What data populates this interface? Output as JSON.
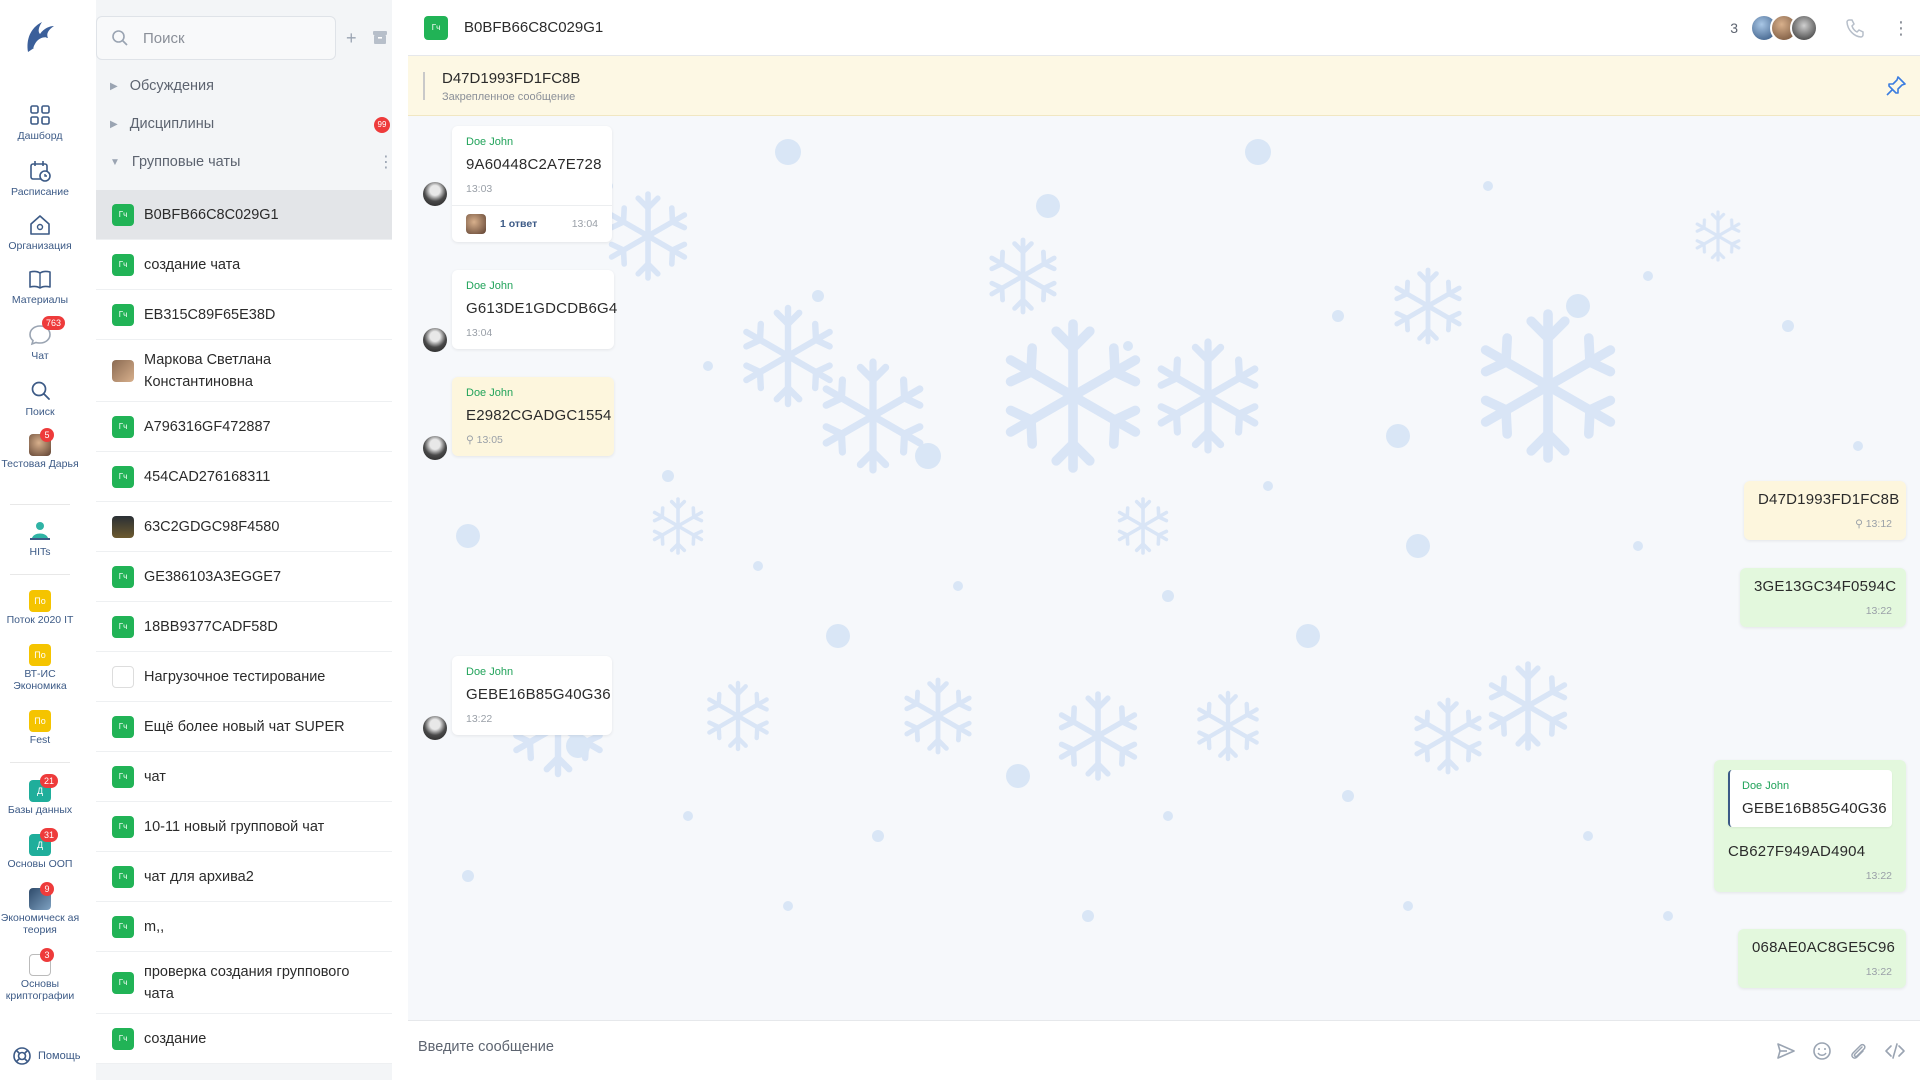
{
  "rail": {
    "items": [
      {
        "label": "Дашборд",
        "icon": "dashboard-icon"
      },
      {
        "label": "Расписание",
        "icon": "calendar-icon"
      },
      {
        "label": "Организация",
        "icon": "home-icon"
      },
      {
        "label": "Материалы",
        "icon": "book-icon"
      },
      {
        "label": "Чат",
        "icon": "chat-icon",
        "badge": "763"
      },
      {
        "label": "Поиск",
        "icon": "search-icon"
      },
      {
        "label": "Тестовая Дарья",
        "icon": "user-avatar",
        "badge": "5"
      },
      {
        "label": "HITs",
        "icon": "hits-logo"
      }
    ],
    "groups": [
      {
        "label": "Поток 2020 IT",
        "abbr": "По",
        "color": "#f5c400"
      },
      {
        "label": "ВТ-ИС Экономика",
        "abbr": "По",
        "color": "#f5c400"
      },
      {
        "label": "Fest",
        "abbr": "По",
        "color": "#f5c400"
      }
    ],
    "disciplines": [
      {
        "label": "Базы данных",
        "abbr": "Д",
        "color": "#1fae9b",
        "badge": "21"
      },
      {
        "label": "Основы ООП",
        "abbr": "Д",
        "color": "#1fae9b",
        "badge": "31"
      },
      {
        "label": "Экономическ ая теория",
        "abbr": "",
        "color": "#4a6a86",
        "badge": "9"
      },
      {
        "label": "Основы криптографии",
        "abbr": "",
        "color": "#8a8f98",
        "badge": "3"
      }
    ],
    "help": "Помощь"
  },
  "list": {
    "search_placeholder": "Поиск",
    "sections": [
      {
        "label": "Обсуждения"
      },
      {
        "label": "Дисциплины",
        "badge": "99"
      },
      {
        "label": "Групповые чаты"
      }
    ],
    "chats": [
      {
        "name": "B0BFB66C8C029G1",
        "avatar": "Гч",
        "active": true
      },
      {
        "name": "создание чата",
        "avatar": "Гч"
      },
      {
        "name": "EB315C89F65E38D",
        "avatar": "Гч"
      },
      {
        "name": "Маркова Светлана Константиновна",
        "avatar": "",
        "kind": "photo"
      },
      {
        "name": "A796316GF472887",
        "avatar": "Гч"
      },
      {
        "name": "454CAD276168311",
        "avatar": "Гч"
      },
      {
        "name": "63C2GDGC98F4580",
        "avatar": "",
        "kind": "dark"
      },
      {
        "name": "GE386103A3EGGE7",
        "avatar": "Гч"
      },
      {
        "name": "18BB9377CADF58D",
        "avatar": "Гч"
      },
      {
        "name": "Нагрузочное тестирование",
        "avatar": "",
        "kind": "net"
      },
      {
        "name": "Ещё более новый чат SUPER",
        "avatar": "Гч"
      },
      {
        "name": "чат",
        "avatar": "Гч"
      },
      {
        "name": "10-11 новый групповой чат",
        "avatar": "Гч"
      },
      {
        "name": "чат для архива2",
        "avatar": "Гч"
      },
      {
        "name": "m,,",
        "avatar": "Гч"
      },
      {
        "name": "проверка создания группового чата",
        "avatar": "Гч"
      },
      {
        "name": "создание",
        "avatar": "Гч"
      }
    ]
  },
  "header": {
    "avatar": "Гч",
    "title": "B0BFB66C8C029G1",
    "member_count": "3"
  },
  "pinned": {
    "text": "D47D1993FD1FC8B",
    "caption": "Закрепленное сообщение"
  },
  "messages": {
    "m1": {
      "author": "Doe John",
      "text": "9A60448C2A7E728",
      "time": "13:03",
      "replies": "1 ответ",
      "reply_time": "13:04"
    },
    "m2": {
      "author": "Doe John",
      "text": "G613DE1GDCDB6G4",
      "time": "13:04"
    },
    "m3": {
      "author": "Doe John",
      "text": "E2982CGADGC1554",
      "time": "13:05"
    },
    "m4": {
      "text": "D47D1993FD1FC8B",
      "time": "13:12"
    },
    "m5": {
      "text": "3GE13GC34F0594C",
      "time": "13:22"
    },
    "m6": {
      "author": "Doe John",
      "text": "GEBE16B85G40G36",
      "time": "13:22"
    },
    "m7": {
      "quote_author": "Doe John",
      "quote_text": "GEBE16B85G40G36",
      "text": "CB627F949AD4904",
      "time": "13:22"
    },
    "m8": {
      "text": "068AE0AC8GE5C96",
      "time": "13:22"
    }
  },
  "composer": {
    "placeholder": "Введите сообщение"
  }
}
